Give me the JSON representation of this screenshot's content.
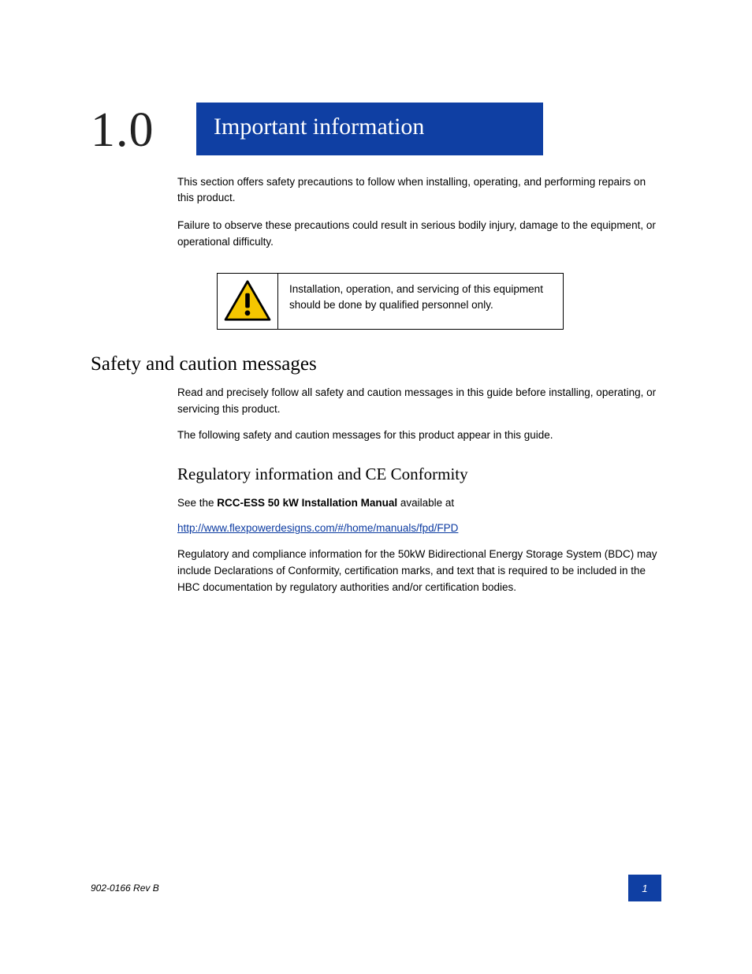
{
  "chapter": {
    "number": "1.0",
    "title": "Important information"
  },
  "intro": {
    "p1": "This section offers safety precautions to follow when installing, operating, and performing repairs on this product.",
    "p2": "Failure to observe these precautions could result in serious bodily injury, damage to the equipment, or operational difficulty."
  },
  "caution": {
    "icon_name": "warning-triangle-icon",
    "text": "Installation, operation, and servicing of this equipment should be done by qualified personnel only."
  },
  "section": {
    "heading": "Safety and caution messages",
    "p1": "Read and precisely follow all safety and caution messages in this guide before installing, operating, or servicing this product.",
    "p2": "The following safety and caution messages for this product appear in this guide."
  },
  "subsection": {
    "heading": "Regulatory information and CE Conformity",
    "p1_prefix": "See the ",
    "p1_em": "RCC-ESS 50 kW Installation Manual",
    "p1_suffix": " available at",
    "link": "http://www.flexpowerdesigns.com/#/home/manuals/fpd/FPD",
    "p2": "Regulatory and compliance information for the 50kW Bidirectional Energy Storage System (BDC) may include Declarations of Conformity, certification marks, and text that is required to be included in the HBC documentation by regulatory authorities and/or certification bodies."
  },
  "footer": {
    "left": "902-0166 Rev B",
    "page": "1"
  }
}
